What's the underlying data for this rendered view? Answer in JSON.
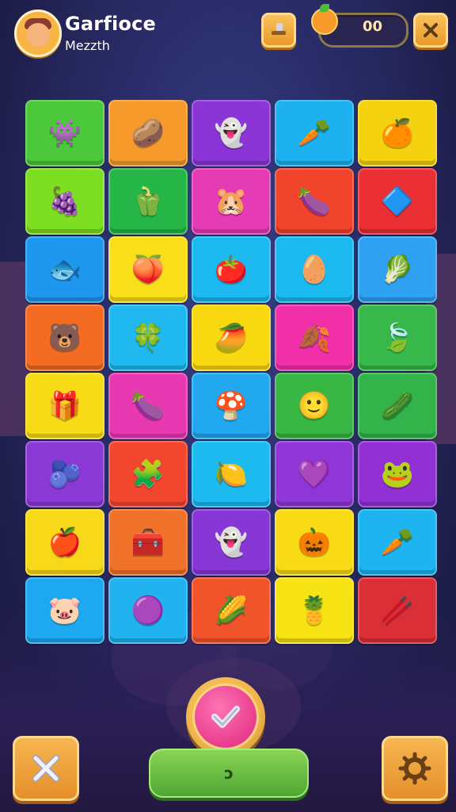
{
  "header": {
    "title": "Garfioce",
    "subtitle": "Mezzth",
    "score": "00",
    "icons": {
      "avatar": "avatar",
      "hammer": "hammer-icon",
      "orange": "orange-icon",
      "close": "close-icon"
    }
  },
  "grid": {
    "rows": 8,
    "cols": 5,
    "tiles": [
      {
        "color": "#4bc93a",
        "glyph": "👾",
        "icon": "creature-icon"
      },
      {
        "color": "#f59a2b",
        "glyph": "🥔",
        "icon": "potato-icon"
      },
      {
        "color": "#8c35d6",
        "glyph": "👻",
        "icon": "ghost-icon"
      },
      {
        "color": "#1eb1f0",
        "glyph": "🥕",
        "icon": "carrot-icon"
      },
      {
        "color": "#f5d20f",
        "glyph": "🍊",
        "icon": "orange-icon"
      },
      {
        "color": "#7dde22",
        "glyph": "🍇",
        "icon": "grape-icon"
      },
      {
        "color": "#26b648",
        "glyph": "🫑",
        "icon": "pepper-icon"
      },
      {
        "color": "#e53bb4",
        "glyph": "🐹",
        "icon": "hamster-icon"
      },
      {
        "color": "#f0442d",
        "glyph": "🍆",
        "icon": "eggplant-icon"
      },
      {
        "color": "#ea2f35",
        "glyph": "🔷",
        "icon": "crystal-icon"
      },
      {
        "color": "#1e97ef",
        "glyph": "🐟",
        "icon": "fish-icon"
      },
      {
        "color": "#f8df1a",
        "glyph": "🍑",
        "icon": "peach-icon"
      },
      {
        "color": "#1cb8f0",
        "glyph": "🍅",
        "icon": "tomato-icon"
      },
      {
        "color": "#1bb9ef",
        "glyph": "🥚",
        "icon": "egg-icon"
      },
      {
        "color": "#2ea2f0",
        "glyph": "🥬",
        "icon": "sprout-icon"
      },
      {
        "color": "#f36c22",
        "glyph": "🐻",
        "icon": "bear-icon"
      },
      {
        "color": "#1fb9ef",
        "glyph": "🍀",
        "icon": "clover-icon"
      },
      {
        "color": "#f8d811",
        "glyph": "🥭",
        "icon": "mango-icon"
      },
      {
        "color": "#f02fa8",
        "glyph": "🍂",
        "icon": "leaf-icon"
      },
      {
        "color": "#38b84a",
        "glyph": "🍃",
        "icon": "leafy-icon"
      },
      {
        "color": "#f7db17",
        "glyph": "🎁",
        "icon": "gift-icon"
      },
      {
        "color": "#e839b2",
        "glyph": "🍆",
        "icon": "beet-icon"
      },
      {
        "color": "#21a8ef",
        "glyph": "🍄",
        "icon": "mushroom-icon"
      },
      {
        "color": "#39b745",
        "glyph": "🙂",
        "icon": "slime-icon"
      },
      {
        "color": "#32b44b",
        "glyph": "🥒",
        "icon": "cucumber-icon"
      },
      {
        "color": "#8b39d4",
        "glyph": "🫐",
        "icon": "berry-icon"
      },
      {
        "color": "#f2462f",
        "glyph": "🧩",
        "icon": "puzzle-icon"
      },
      {
        "color": "#1dbaf0",
        "glyph": "🍋",
        "icon": "lemon-icon"
      },
      {
        "color": "#8e37d6",
        "glyph": "💜",
        "icon": "purple-gem-icon"
      },
      {
        "color": "#9131d4",
        "glyph": "🐸",
        "icon": "frog-icon"
      },
      {
        "color": "#f8d91a",
        "glyph": "🍎",
        "icon": "apple-icon"
      },
      {
        "color": "#f0722a",
        "glyph": "🧰",
        "icon": "toolbox-icon"
      },
      {
        "color": "#8737d6",
        "glyph": "👻",
        "icon": "ghost-2-icon"
      },
      {
        "color": "#f8db15",
        "glyph": "🎃",
        "icon": "pumpkin-icon"
      },
      {
        "color": "#1eb4ef",
        "glyph": "🥕",
        "icon": "carrot-2-icon"
      },
      {
        "color": "#1ea8ef",
        "glyph": "🐷",
        "icon": "pig-icon"
      },
      {
        "color": "#21b3ef",
        "glyph": "🟣",
        "icon": "orb-icon"
      },
      {
        "color": "#f1532b",
        "glyph": "🌽",
        "icon": "corn-icon"
      },
      {
        "color": "#f7e314",
        "glyph": "🍍",
        "icon": "pineapple-icon"
      },
      {
        "color": "#db2f38",
        "glyph": "🥢",
        "icon": "chopstick-icon"
      }
    ]
  },
  "controls": {
    "confirm_icon": "checkmark-icon",
    "cancel_icon": "close-icon",
    "settings_icon": "gear-icon",
    "green_label": "ↄ"
  }
}
